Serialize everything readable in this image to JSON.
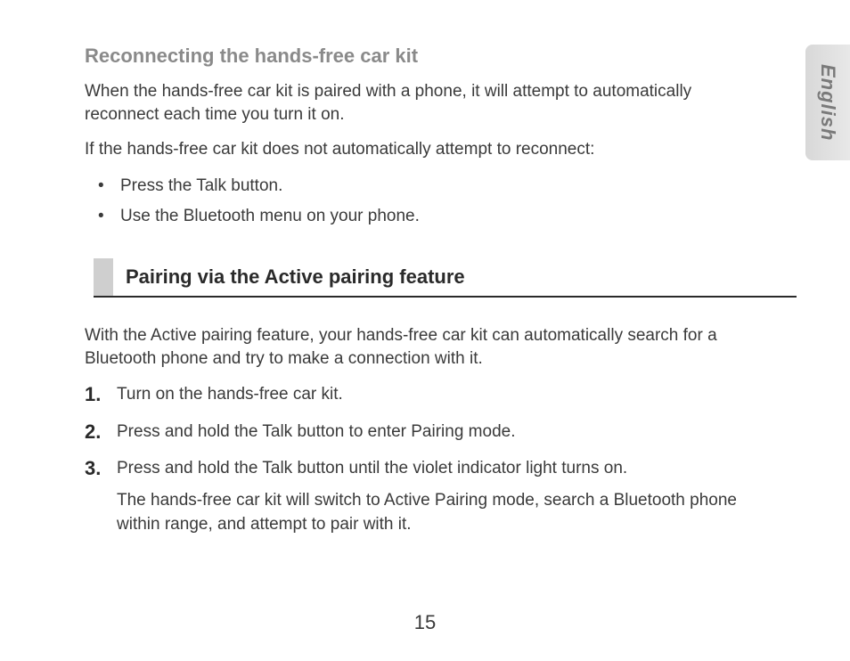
{
  "languageTab": "English",
  "section1": {
    "heading": "Reconnecting the hands-free car kit",
    "para1": "When the hands-free car kit is paired with a phone, it will attempt to automatically reconnect each time you turn it on.",
    "para2": "If the hands-free car kit does not automatically attempt to reconnect:",
    "bullets": [
      "Press the Talk button.",
      "Use the Bluetooth menu on your phone."
    ]
  },
  "section2": {
    "barTitle": "Pairing via the Active pairing feature",
    "intro": "With the Active pairing feature, your hands-free car kit can automatically search for a Bluetooth phone and try to make a connection with it.",
    "steps": [
      {
        "num": "1.",
        "text": "Turn on the hands-free car kit."
      },
      {
        "num": "2.",
        "text": "Press and hold the Talk button to enter Pairing mode."
      },
      {
        "num": "3.",
        "text": "Press and hold the Talk button until the violet indicator light turns on.",
        "sub": "The hands-free car kit will switch to Active Pairing mode, search a Bluetooth phone within range, and attempt to pair with it."
      }
    ]
  },
  "pageNumber": "15"
}
